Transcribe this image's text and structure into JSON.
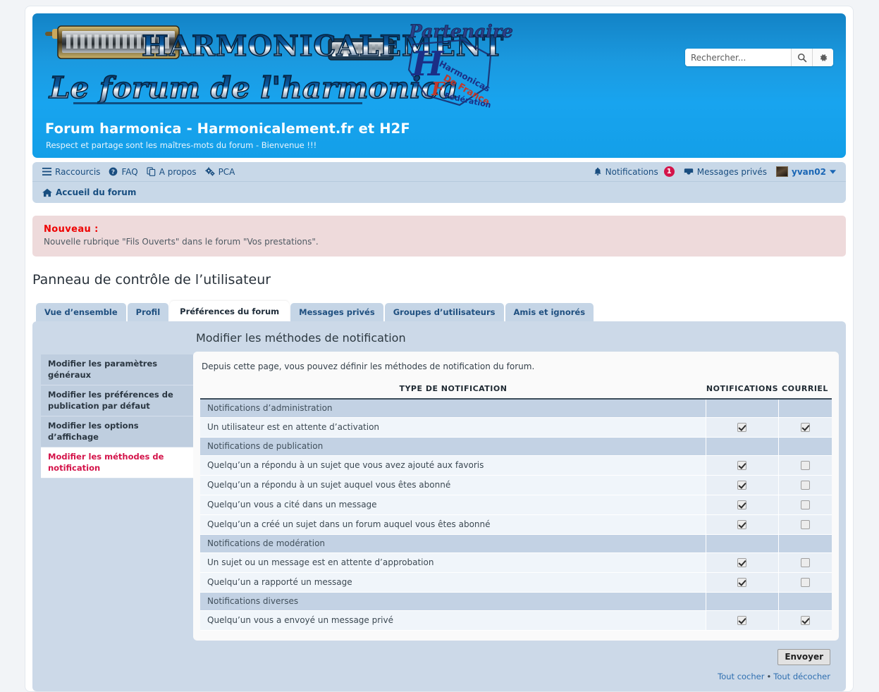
{
  "site": {
    "title": "Forum harmonica - Harmonicalement.fr et H2F",
    "description": "Respect et partage sont les maîtres-mots du forum - Bienvenue !!!",
    "logo_main_text": "HARMONICALEMENT",
    "logo_sub_text": "Le forum de l'harmonica",
    "logo_partner_text": "Partenaire",
    "logo_partner_mark": "H2F"
  },
  "search": {
    "placeholder": "Rechercher...",
    "value": "",
    "search_icon": "search-icon",
    "advanced_icon": "gear-icon"
  },
  "nav": {
    "items": [
      {
        "label": "Raccourcis",
        "icon": "hamburger-menu-icon"
      },
      {
        "label": "FAQ",
        "icon": "question-circle-icon"
      },
      {
        "label": "A propos",
        "icon": "copy-icon"
      },
      {
        "label": "PCA",
        "icon": "cogs-icon"
      }
    ],
    "notifications": {
      "label": "Notifications",
      "count": "1",
      "icon": "bell-icon"
    },
    "private_messages": {
      "label": "Messages privés",
      "icon": "inbox-icon"
    },
    "user": {
      "name": "yvan02",
      "avatar": "user-avatar",
      "caret": "chevron-down-icon"
    },
    "breadcrumb": {
      "label": "Accueil du forum",
      "icon": "home-icon"
    }
  },
  "announcement": {
    "title": "Nouveau :",
    "text": "Nouvelle rubrique \"Fils Ouverts\" dans le forum \"Vos prestations\"."
  },
  "page": {
    "title": "Panneau de contrôle de l’utilisateur"
  },
  "tabs": [
    {
      "label": "Vue d’ensemble",
      "active": false
    },
    {
      "label": "Profil",
      "active": false
    },
    {
      "label": "Préférences du forum",
      "active": true
    },
    {
      "label": "Messages privés",
      "active": false
    },
    {
      "label": "Groupes d’utilisateurs",
      "active": false
    },
    {
      "label": "Amis et ignorés",
      "active": false
    }
  ],
  "sidebar": {
    "items": [
      {
        "label": "Modifier les paramètres généraux",
        "active": false
      },
      {
        "label": "Modifier les préférences de publication par défaut",
        "active": false
      },
      {
        "label": "Modifier les options d’affichage",
        "active": false
      },
      {
        "label": "Modifier les méthodes de notification",
        "active": true
      }
    ]
  },
  "panel": {
    "heading": "Modifier les méthodes de notification",
    "intro": "Depuis cette page, vous pouvez définir les méthodes de notification du forum.",
    "columns": {
      "type": "TYPE DE NOTIFICATION",
      "notifications": "NOTIFICATIONS",
      "email": "COURRIEL"
    },
    "rows": [
      {
        "kind": "category",
        "label": "Notifications d’administration"
      },
      {
        "kind": "option",
        "label": "Un utilisateur est en attente d’activation",
        "notifications": true,
        "email": true
      },
      {
        "kind": "category",
        "label": "Notifications de publication"
      },
      {
        "kind": "option",
        "label": "Quelqu’un a répondu à un sujet que vous avez ajouté aux favoris",
        "notifications": true,
        "email": false
      },
      {
        "kind": "option",
        "label": "Quelqu’un a répondu à un sujet auquel vous êtes abonné",
        "notifications": true,
        "email": false
      },
      {
        "kind": "option",
        "label": "Quelqu’un vous a cité dans un message",
        "notifications": true,
        "email": false
      },
      {
        "kind": "option",
        "label": "Quelqu’un a créé un sujet dans un forum auquel vous êtes abonné",
        "notifications": true,
        "email": false
      },
      {
        "kind": "category",
        "label": "Notifications de modération"
      },
      {
        "kind": "option",
        "label": "Un sujet ou un message est en attente d’approbation",
        "notifications": true,
        "email": false
      },
      {
        "kind": "option",
        "label": "Quelqu’un a rapporté un message",
        "notifications": true,
        "email": false
      },
      {
        "kind": "category",
        "label": "Notifications diverses"
      },
      {
        "kind": "option",
        "label": "Quelqu’un vous a envoyé un message privé",
        "notifications": true,
        "email": true
      }
    ],
    "submit_label": "Envoyer",
    "check_all_label": "Tout cocher",
    "uncheck_all_label": "Tout décocher",
    "links_separator": "•"
  },
  "colors": {
    "banner_blue": "#18a4ef",
    "nav_blue": "#c8d8e8",
    "announce_pink": "#eedadb",
    "announce_red": "#ee0000",
    "accent_crimson": "#d4144a",
    "link_blue": "#2f6fb0",
    "category_row": "#c3d2e4",
    "option_row": "#f0f5fa"
  }
}
